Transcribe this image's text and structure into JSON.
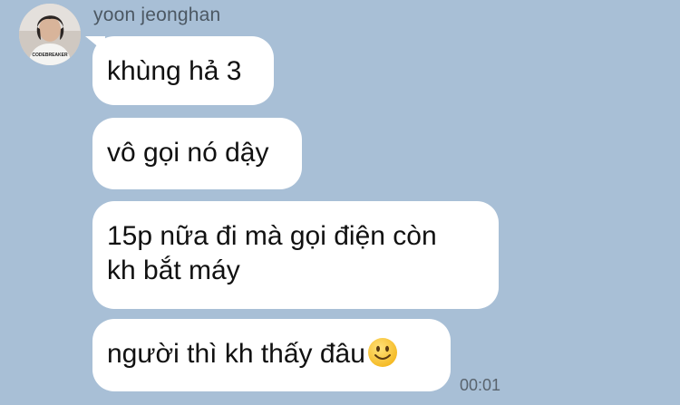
{
  "chat": {
    "sender_name": "yoon jeonghan",
    "avatar_shirt_text": "CODEBREAKER",
    "messages": [
      {
        "text": "khùng hả 3"
      },
      {
        "text": "vô gọi nó dậy"
      },
      {
        "text": "15p nữa đi mà gọi điện còn\nkh bắt máy"
      },
      {
        "text": "người thì kh thấy đâu",
        "emoji": "slightly-smiling-face-icon"
      }
    ],
    "timestamp": "00:01"
  },
  "colors": {
    "background": "#a8bfd6",
    "bubble": "#ffffff",
    "sender_text": "#4c5863",
    "timestamp_text": "#59636d",
    "emoji_face": "#f7c531"
  }
}
